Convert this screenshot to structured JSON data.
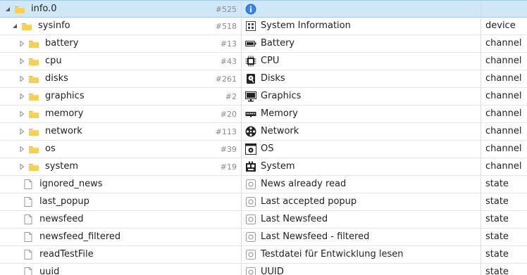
{
  "tree": {
    "rows": [
      {
        "name": "info.0",
        "count": "#525",
        "desc": "",
        "type": "",
        "level": 0,
        "expanded": true,
        "hasToggle": true,
        "kind": "folder",
        "descIcon": "info-icon",
        "selected": true
      },
      {
        "name": "sysinfo",
        "count": "#518",
        "desc": "System Information",
        "type": "device",
        "level": 1,
        "expanded": true,
        "hasToggle": true,
        "kind": "folder",
        "descIcon": "system-info-icon"
      },
      {
        "name": "battery",
        "count": "#13",
        "desc": "Battery",
        "type": "channel",
        "level": 2,
        "expanded": false,
        "hasToggle": true,
        "kind": "folder",
        "descIcon": "battery-icon"
      },
      {
        "name": "cpu",
        "count": "#43",
        "desc": "CPU",
        "type": "channel",
        "level": 2,
        "expanded": false,
        "hasToggle": true,
        "kind": "folder",
        "descIcon": "cpu-icon"
      },
      {
        "name": "disks",
        "count": "#261",
        "desc": "Disks",
        "type": "channel",
        "level": 2,
        "expanded": false,
        "hasToggle": true,
        "kind": "folder",
        "descIcon": "disk-icon"
      },
      {
        "name": "graphics",
        "count": "#2",
        "desc": "Graphics",
        "type": "channel",
        "level": 2,
        "expanded": false,
        "hasToggle": true,
        "kind": "folder",
        "descIcon": "monitor-icon"
      },
      {
        "name": "memory",
        "count": "#20",
        "desc": "Memory",
        "type": "channel",
        "level": 2,
        "expanded": false,
        "hasToggle": true,
        "kind": "folder",
        "descIcon": "memory-icon"
      },
      {
        "name": "network",
        "count": "#113",
        "desc": "Network",
        "type": "channel",
        "level": 2,
        "expanded": false,
        "hasToggle": true,
        "kind": "folder",
        "descIcon": "network-icon"
      },
      {
        "name": "os",
        "count": "#39",
        "desc": "OS",
        "type": "channel",
        "level": 2,
        "expanded": false,
        "hasToggle": true,
        "kind": "folder",
        "descIcon": "os-icon"
      },
      {
        "name": "system",
        "count": "#19",
        "desc": "System",
        "type": "channel",
        "level": 2,
        "expanded": false,
        "hasToggle": true,
        "kind": "folder",
        "descIcon": "system-icon"
      },
      {
        "name": "ignored_news",
        "count": "",
        "desc": "News already read",
        "type": "state",
        "level": 1,
        "expanded": false,
        "hasToggle": false,
        "kind": "file",
        "descIcon": "state-icon"
      },
      {
        "name": "last_popup",
        "count": "",
        "desc": "Last accepted popup",
        "type": "state",
        "level": 1,
        "expanded": false,
        "hasToggle": false,
        "kind": "file",
        "descIcon": "state-icon"
      },
      {
        "name": "newsfeed",
        "count": "",
        "desc": "Last Newsfeed",
        "type": "state",
        "level": 1,
        "expanded": false,
        "hasToggle": false,
        "kind": "file",
        "descIcon": "state-icon"
      },
      {
        "name": "newsfeed_filtered",
        "count": "",
        "desc": "Last Newsfeed - filtered",
        "type": "state",
        "level": 1,
        "expanded": false,
        "hasToggle": false,
        "kind": "file",
        "descIcon": "state-icon"
      },
      {
        "name": "readTestFile",
        "count": "",
        "desc": "Testdatei für Entwicklung lesen",
        "type": "state",
        "level": 1,
        "expanded": false,
        "hasToggle": false,
        "kind": "file",
        "descIcon": "state-icon"
      },
      {
        "name": "uuid",
        "count": "",
        "desc": "UUID",
        "type": "state",
        "level": 1,
        "expanded": false,
        "hasToggle": false,
        "kind": "file",
        "descIcon": "state-icon"
      }
    ]
  },
  "colors": {
    "selected_bg": "#cfe7f6",
    "folder": "#f2c744",
    "count": "#8a8a8a",
    "info": "#2a6fd6"
  }
}
